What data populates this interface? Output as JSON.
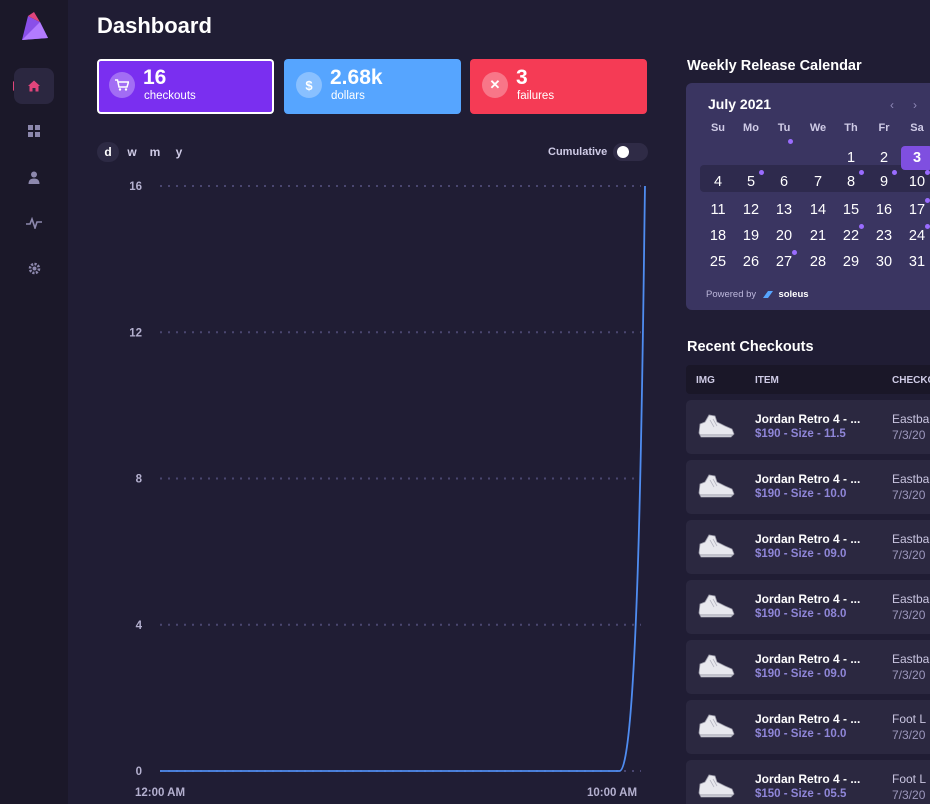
{
  "page": {
    "title": "Dashboard"
  },
  "stats": [
    {
      "value": "16",
      "label": "checkouts",
      "icon": "cart-icon",
      "color": "#7a2ff0"
    },
    {
      "value": "2.68k",
      "label": "dollars",
      "icon": "dollar-icon",
      "color": "#56a5ff"
    },
    {
      "value": "3",
      "label": "failures",
      "icon": "x-icon",
      "color": "#f53b55"
    }
  ],
  "periods": [
    "d",
    "w",
    "m",
    "y"
  ],
  "selected_period": "d",
  "cumulative": {
    "label": "Cumulative",
    "enabled": false
  },
  "chart_data": {
    "type": "line",
    "x_tick_labels": [
      "12:00 AM",
      "10:00 AM"
    ],
    "y_ticks": [
      0,
      4,
      8,
      12,
      16
    ],
    "ylim": [
      0,
      16
    ],
    "series": [
      {
        "values": [
          0,
          0,
          0,
          0,
          0,
          0,
          0,
          0,
          0,
          0,
          0,
          0,
          0,
          0,
          0,
          0,
          0,
          0,
          0,
          16
        ]
      }
    ],
    "line_color": "#4f8cf0",
    "grid": true
  },
  "calendar": {
    "section_title": "Weekly Release Calendar",
    "month": "July 2021",
    "prev": "‹",
    "next": "›",
    "weekdays": [
      "Su",
      "Mo",
      "Tu",
      "We",
      "Th",
      "Fr",
      "Sa"
    ],
    "weeks": [
      [
        "",
        "",
        "",
        "",
        "1",
        "2",
        "3"
      ],
      [
        "4",
        "5",
        "6",
        "7",
        "8",
        "9",
        "10"
      ],
      [
        "11",
        "12",
        "13",
        "14",
        "15",
        "16",
        "17"
      ],
      [
        "18",
        "19",
        "20",
        "21",
        "22",
        "23",
        "24"
      ],
      [
        "25",
        "26",
        "27",
        "28",
        "29",
        "30",
        "31"
      ]
    ],
    "today": "3",
    "powered_by": "Powered by",
    "brand": "soleus"
  },
  "checkouts": {
    "section_title": "Recent Checkouts",
    "columns": [
      "IMG",
      "ITEM",
      "CHECKO"
    ],
    "rows": [
      {
        "name": "Jordan Retro 4 - ...",
        "detail": "$190 - Size - 11.5",
        "store": "Eastba",
        "date": "7/3/20"
      },
      {
        "name": "Jordan Retro 4 - ...",
        "detail": "$190 - Size - 10.0",
        "store": "Eastba",
        "date": "7/3/20"
      },
      {
        "name": "Jordan Retro 4 - ...",
        "detail": "$190 - Size - 09.0",
        "store": "Eastba",
        "date": "7/3/20"
      },
      {
        "name": "Jordan Retro 4 - ...",
        "detail": "$190 - Size - 08.0",
        "store": "Eastba",
        "date": "7/3/20"
      },
      {
        "name": "Jordan Retro 4 - ...",
        "detail": "$190 - Size - 09.0",
        "store": "Eastba",
        "date": "7/3/20"
      },
      {
        "name": "Jordan Retro 4 - ...",
        "detail": "$190 - Size - 10.0",
        "store": "Foot L",
        "date": "7/3/20"
      },
      {
        "name": "Jordan Retro 4 - ...",
        "detail": "$150 - Size - 05.5",
        "store": "Foot L",
        "date": "7/3/20"
      }
    ]
  }
}
